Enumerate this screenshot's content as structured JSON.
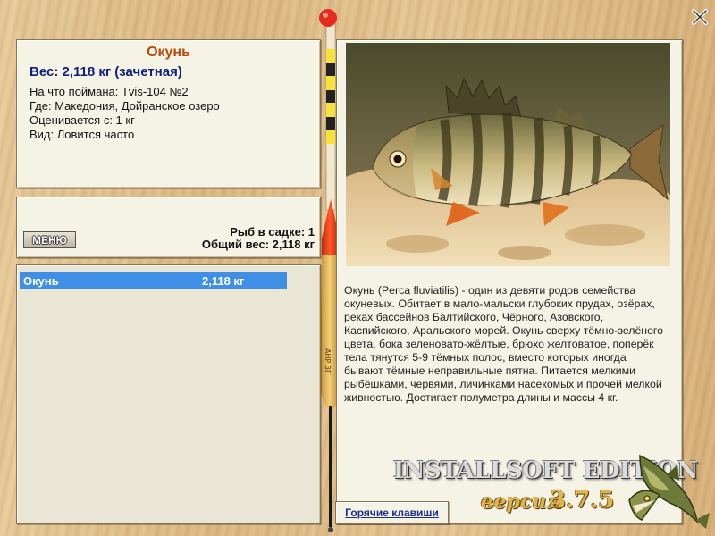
{
  "fish_info": {
    "name": "Окунь",
    "weight_line": "Вес: 2,118 кг (зачетная)",
    "bait_line": "На что поймана: Tvis-104 №2",
    "place_line": "Где: Македония, Дойранское озеро",
    "score_line": "Оценивается с: 1 кг",
    "kind_line": "Вид: Ловится часто"
  },
  "keepnet": {
    "menu_label": "МЕНЮ",
    "fish_count_line": "Рыб в садке: 1",
    "total_weight_line": "Общий вес: 2,118 кг"
  },
  "catch_list": [
    {
      "name": "Окунь",
      "weight": "2,118 кг",
      "selected": true
    }
  ],
  "description": "Окунь (Perca fluviatilis) - один из девяти родов семейства окуневых. Обитает в мало-мальски глубоких прудах, озёрах, реках бассейнов Балтийского, Чёрного, Азовского, Каспийского, Аральского морей. Окунь сверху тёмно-зелёного цвета, бока зеленовато-жёлтые, брюхо желтоватое, поперёк тела тянутся 5-9 тёмных полос, вместо которых иногда бывают тёмные неправильные пятна. Питается мелкими рыбёшками, червями, личинками насекомых и прочей мелкой живностью. Достигает полуметра длины и массы 4 кг.",
  "hotkeys_label": "Горячие клавиши",
  "branding": {
    "edition": "INSTALLSOFT EDITION",
    "version_label": "версия",
    "version_number": "3.7.5"
  },
  "float_marking": "АНР 3Г",
  "icons": {
    "close": "close-icon",
    "float": "fishing-float-icon",
    "pike": "pike-fish-icon"
  },
  "colors": {
    "title": "#b54a0c",
    "weight": "#11207a",
    "selection": "#3f8fe6",
    "panel": "#f5f2e6",
    "brand_gold": "#e0b64a"
  }
}
